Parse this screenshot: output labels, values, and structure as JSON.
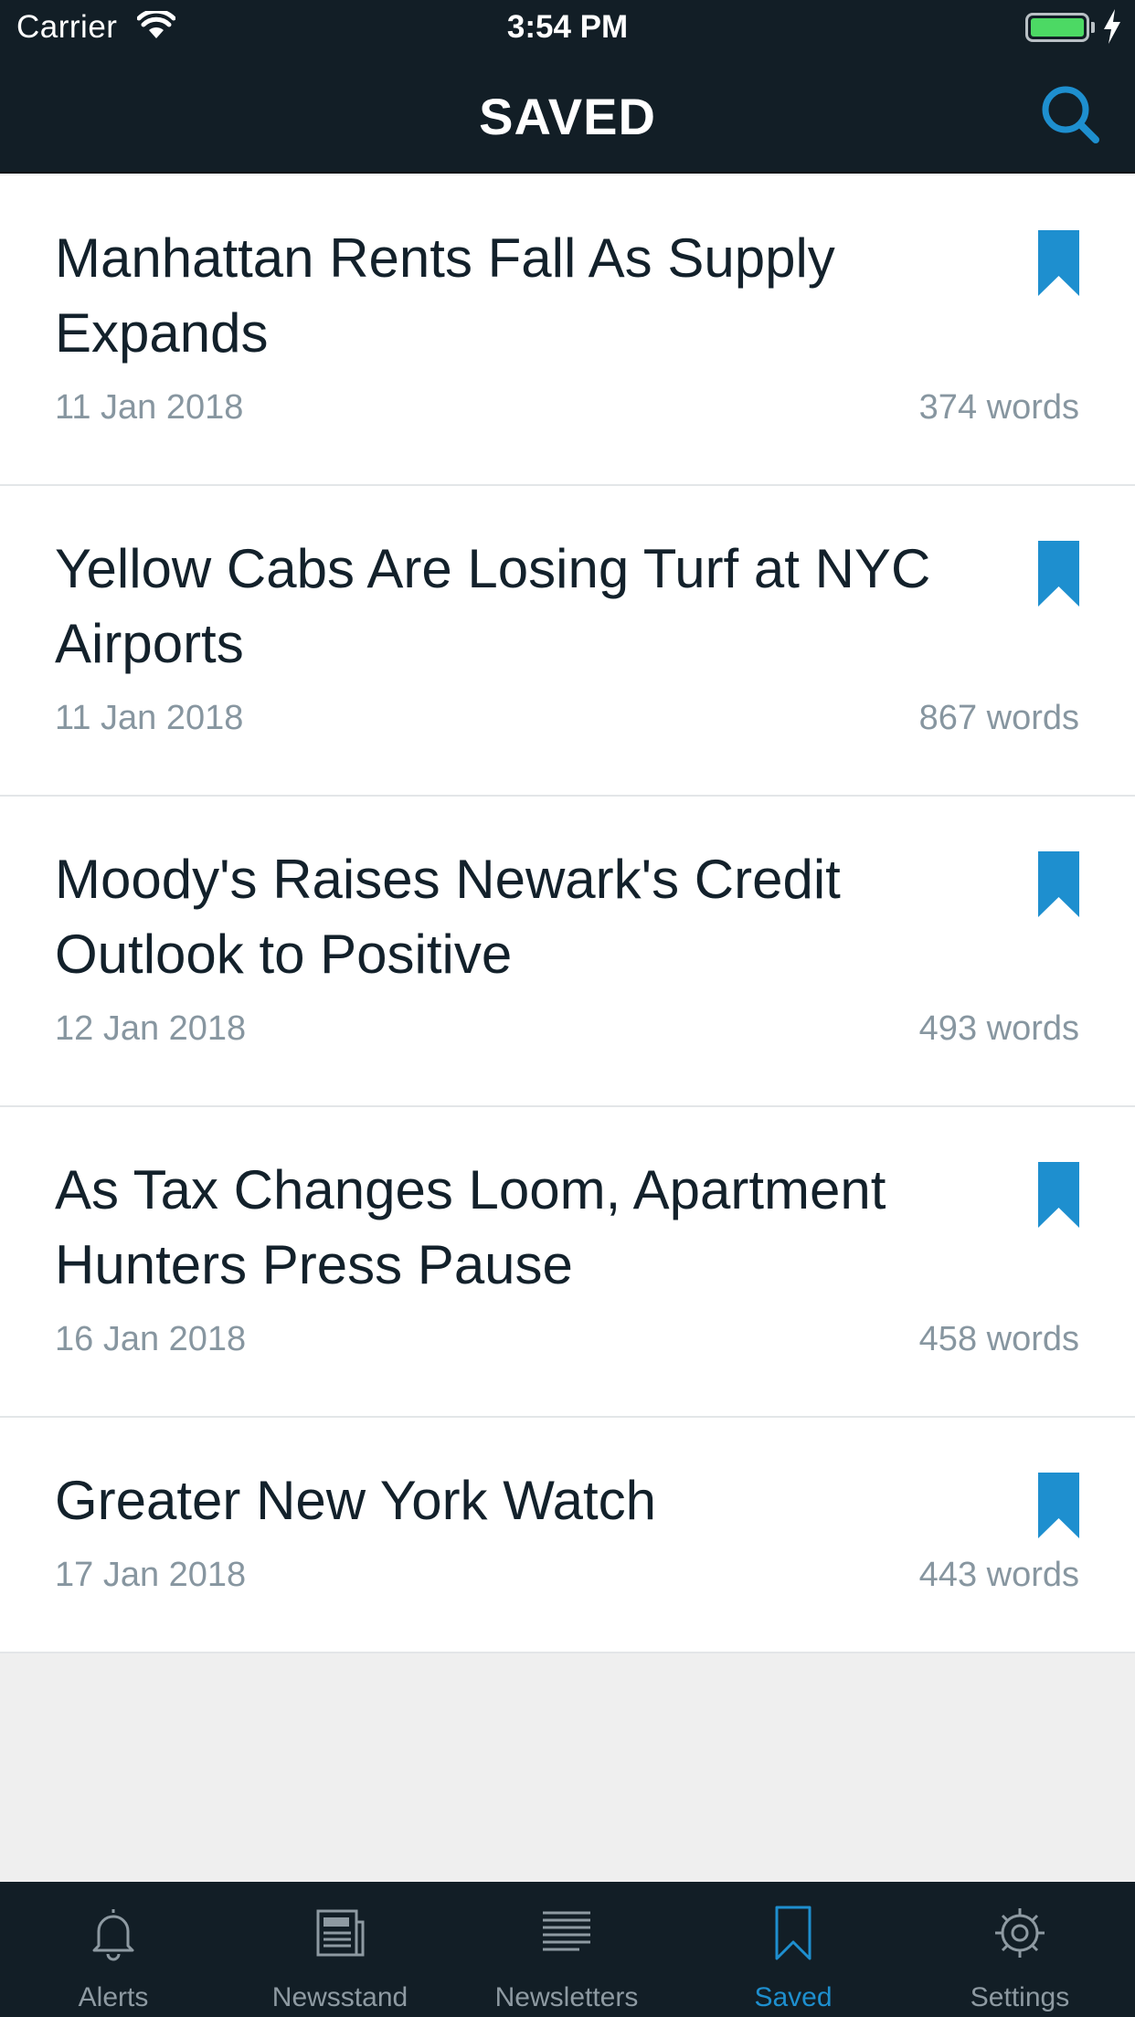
{
  "status_bar": {
    "carrier": "Carrier",
    "time": "3:54 PM"
  },
  "header": {
    "title": "SAVED",
    "search_icon": "search-icon"
  },
  "articles": [
    {
      "title": "Manhattan Rents Fall As Supply Expands",
      "date": "11 Jan 2018",
      "words": "374 words"
    },
    {
      "title": "Yellow Cabs Are Losing Turf at NYC Airports",
      "date": "11 Jan 2018",
      "words": "867 words"
    },
    {
      "title": "Moody's Raises Newark's Credit Outlook to Positive",
      "date": "12 Jan 2018",
      "words": "493 words"
    },
    {
      "title": "As Tax Changes Loom, Apartment Hunters Press Pause",
      "date": "16 Jan 2018",
      "words": "458 words"
    },
    {
      "title": "Greater New York Watch",
      "date": "17 Jan 2018",
      "words": "443 words"
    }
  ],
  "tabs": [
    {
      "label": "Alerts",
      "icon": "bell-icon"
    },
    {
      "label": "Newsstand",
      "icon": "newspaper-icon"
    },
    {
      "label": "Newsletters",
      "icon": "lines-icon"
    },
    {
      "label": "Saved",
      "icon": "bookmark-icon",
      "active": true
    },
    {
      "label": "Settings",
      "icon": "gear-icon"
    }
  ],
  "colors": {
    "header_bg": "#121e26",
    "accent": "#1e8fcf",
    "title_text": "#13212b",
    "meta_text": "#8796a0",
    "empty_bg": "#efefef"
  }
}
